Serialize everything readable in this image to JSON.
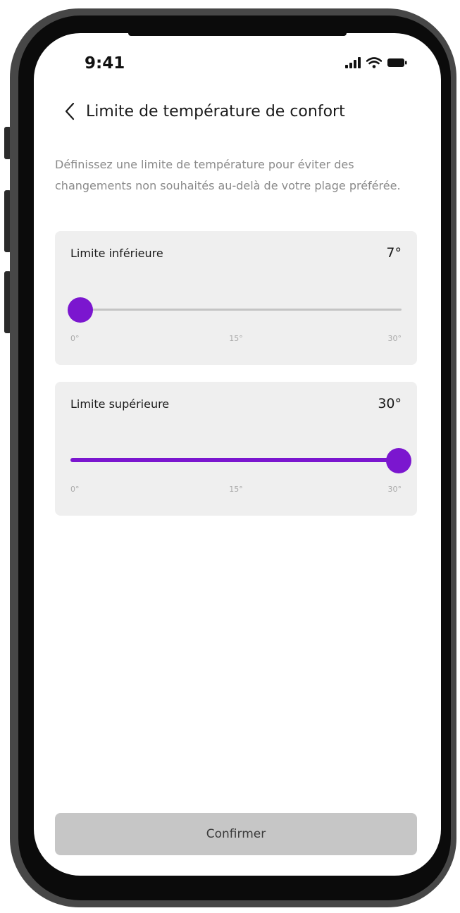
{
  "status_bar": {
    "time": "9:41",
    "icons": [
      "cellular-signal-icon",
      "wifi-icon",
      "battery-icon"
    ]
  },
  "header": {
    "back_icon": "chevron-left-icon",
    "title": "Limite de température de confort"
  },
  "description": "Définissez une limite de température pour éviter des changements non souhaités au-delà de votre plage préférée.",
  "lower_limit": {
    "label": "Limite inférieure",
    "value_text": "7°",
    "value": 7,
    "min": 0,
    "max": 30,
    "ticks": [
      "0°",
      "15°",
      "30°"
    ]
  },
  "upper_limit": {
    "label": "Limite supérieure",
    "value_text": "30°",
    "value": 30,
    "min": 0,
    "max": 30,
    "ticks": [
      "0°",
      "15°",
      "30°"
    ]
  },
  "confirm_label": "Confirmer",
  "colors": {
    "accent": "#7b16cf",
    "card_background": "#efefef",
    "track": "#c4c4c4",
    "button_disabled": "#c6c6c6",
    "phone_frame": "#474747"
  }
}
